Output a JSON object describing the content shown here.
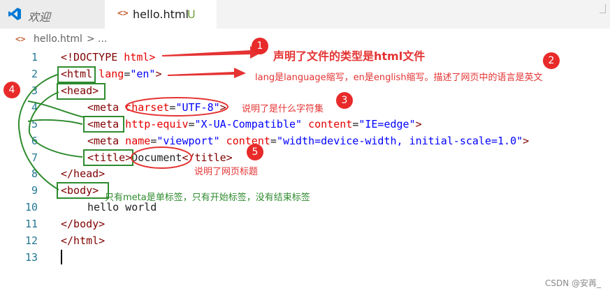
{
  "tabs": {
    "welcome": "欢迎",
    "hello": {
      "icon": "<>",
      "label": "hello.html",
      "status": "U"
    }
  },
  "breadcrumb": {
    "icon": "<>",
    "file": "hello.html",
    "separator": ">",
    "more": "..."
  },
  "line_numbers": [
    "1",
    "2",
    "3",
    "4",
    "5",
    "6",
    "7",
    "8",
    "9",
    "10",
    "11",
    "12",
    "13"
  ],
  "code": {
    "l1": {
      "open": "<!DOCTYPE",
      "rest": " html>"
    },
    "l2": {
      "tag": "<html",
      "attr": " lang",
      "eq": "=",
      "val": "\"en\"",
      "close": ">"
    },
    "l3": {
      "tag": "<head>"
    },
    "l4": {
      "tag": "<meta",
      "attr": " charset",
      "eq": "=",
      "val": "\"UTF-8\"",
      "close": ">"
    },
    "l5": {
      "tag": "<meta",
      "attr1": " http-equiv",
      "eq1": "=",
      "val1": "\"X-UA-Compatible\"",
      "attr2": " content",
      "eq2": "=",
      "val2": "\"IE=edge\"",
      "close": ">"
    },
    "l6": {
      "tag": "<meta",
      "attr1": " name",
      "eq1": "=",
      "val1": "\"viewport\"",
      "attr2": " content",
      "eq2": "=",
      "val2": "\"width=device-width, initial-scale=1.0\"",
      "close": ">"
    },
    "l7": {
      "open": "<title>",
      "text": "Document",
      "close": "</title>"
    },
    "l8": {
      "tag": "</head>"
    },
    "l9": {
      "tag": "<body>"
    },
    "l10": {
      "text": "hello world"
    },
    "l11": {
      "tag": "</body>"
    },
    "l12": {
      "tag": "</html>"
    }
  },
  "annotations": {
    "a1": "声明了文件的类型是html文件",
    "a2": "lang是language缩写，en是english缩写。描述了网页中的语言是英文",
    "a3": "说明了是什么字符集",
    "a4": "只有meta是单标签，只有开始标签，没有结束标签",
    "a5": "说明了网页标题"
  },
  "badges": [
    "1",
    "2",
    "3",
    "4",
    "5"
  ],
  "watermark": "CSDN @安苒_",
  "colors": {
    "annotation_red": "#e53333",
    "annotation_green": "#2e8b2e",
    "tag": "#800000",
    "attribute": "#e50000",
    "string": "#0000ff",
    "line_number": "#237893"
  },
  "icons": {
    "app_logo": "vscode-icon",
    "html_file": "html-file-icon",
    "breadcrumb_file": "html-file-icon"
  }
}
